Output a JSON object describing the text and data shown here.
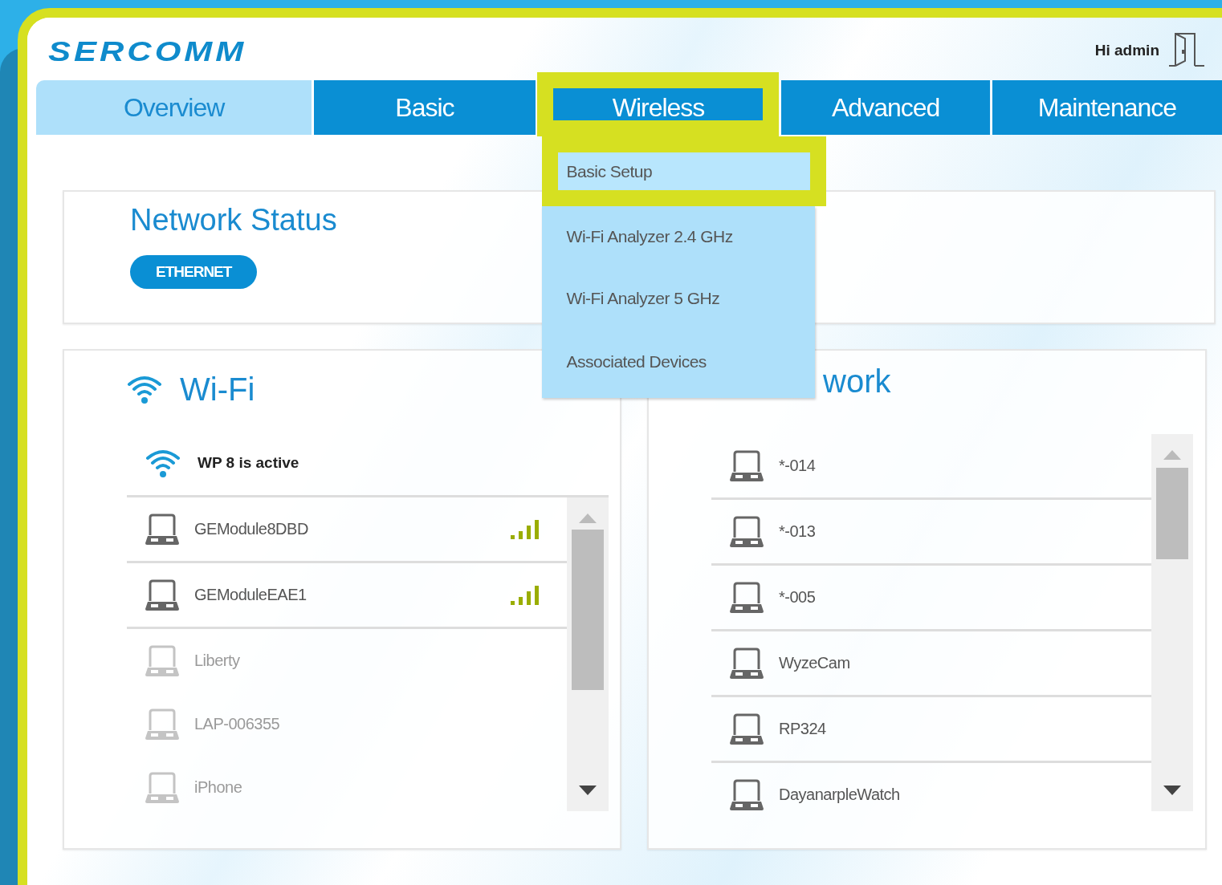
{
  "header": {
    "logo": "SERCOMM",
    "greeting": "Hi admin"
  },
  "tabs": [
    {
      "label": "Overview",
      "selected": true,
      "expanded": false,
      "highlighted": false
    },
    {
      "label": "Basic",
      "selected": false,
      "expanded": false,
      "highlighted": false
    },
    {
      "label": "Wireless",
      "selected": false,
      "expanded": true,
      "highlighted": true
    },
    {
      "label": "Advanced",
      "selected": false,
      "expanded": false,
      "highlighted": false
    },
    {
      "label": "Maintenance",
      "selected": false,
      "expanded": false,
      "highlighted": false
    }
  ],
  "menu": {
    "items": [
      {
        "label": "Basic Setup",
        "selected": true,
        "highlighted": true
      },
      {
        "label": "Wi-Fi Analyzer 2.4 GHz",
        "selected": false,
        "highlighted": false
      },
      {
        "label": "Wi-Fi Analyzer 5 GHz",
        "selected": false,
        "highlighted": false
      },
      {
        "label": "Associated Devices",
        "selected": false,
        "highlighted": false
      }
    ]
  },
  "network_status": {
    "title": "Network Status",
    "badge": "ETHERNET"
  },
  "wifi": {
    "title": "Wi-Fi",
    "status": "WP 8 is active",
    "devices": [
      {
        "name": "GEModule8DBD",
        "active": true
      },
      {
        "name": "GEModuleEAE1",
        "active": true
      },
      {
        "name": "Liberty",
        "active": false
      },
      {
        "name": "LAP-006355",
        "active": false
      },
      {
        "name": "iPhone",
        "active": false
      }
    ]
  },
  "home_network": {
    "title": "work",
    "devices": [
      {
        "name": "*-014",
        "active": true
      },
      {
        "name": "*-013",
        "active": true
      },
      {
        "name": "*-005",
        "active": true
      },
      {
        "name": "WyzeCam",
        "active": true
      },
      {
        "name": "RP324",
        "active": true
      },
      {
        "name": "DayanarpleWatch",
        "active": true
      }
    ]
  }
}
